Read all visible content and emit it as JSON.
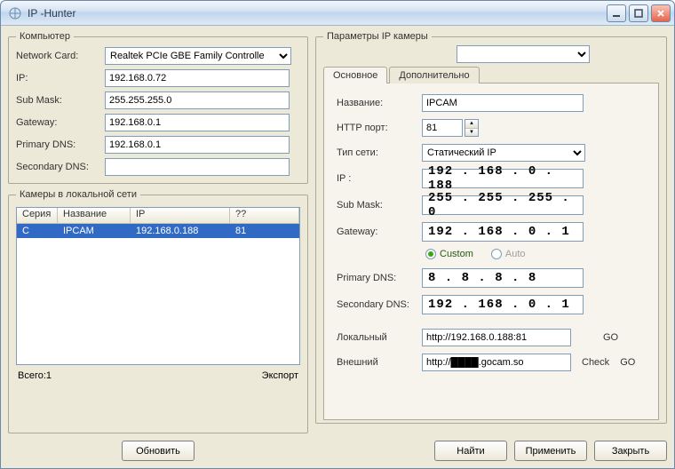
{
  "window": {
    "title": "IP -Hunter"
  },
  "computer": {
    "legend": "Компьютер",
    "network_card_label": "Network Card:",
    "network_card_value": "Realtek PCIe GBE Family Controlle",
    "ip_label": "IP:",
    "ip_value": "192.168.0.72",
    "submask_label": "Sub Mask:",
    "submask_value": "255.255.255.0",
    "gateway_label": "Gateway:",
    "gateway_value": "192.168.0.1",
    "pdns_label": "Primary DNS:",
    "pdns_value": "192.168.0.1",
    "sdns_label": "Secondary DNS:",
    "sdns_value": ""
  },
  "lan": {
    "legend": "Камеры в локальной сети",
    "cols": {
      "serial": "Серия",
      "name": "Название",
      "ip": "IP",
      "unk": "??"
    },
    "rows": [
      {
        "serial": "C",
        "name": "IPCAM",
        "ip": "192.168.0.188",
        "unk": "81",
        "selected": true
      }
    ],
    "total_label": "Всего:1",
    "export_label": "Экспорт"
  },
  "params": {
    "legend": "Параметры IP камеры",
    "selector_value": "",
    "tab_basic": "Основное",
    "tab_adv": "Дополнительно",
    "name_label": "Название:",
    "name_value": "IPCAM",
    "http_label": "HTTP порт:",
    "http_value": "81",
    "nettype_label": "Тип сети:",
    "nettype_value": "Статический IP",
    "ip_label": "IP  :",
    "ip_value": "192 . 168 .  0  . 188",
    "submask_label": "Sub Mask:",
    "submask_value": "255 . 255 . 255 .  0",
    "gateway_label": "Gateway:",
    "gateway_value": "192 . 168 .  0  .  1",
    "radio_custom": "Custom",
    "radio_auto": "Auto",
    "pdns_label": "Primary DNS:",
    "pdns_value": "  8  .  8  .  8  .  8",
    "sdns_label": "Secondary DNS:",
    "sdns_value": "192 . 168 .  0  .  1",
    "local_label": "Локальный",
    "local_value": "http://192.168.0.188:81",
    "ext_label": "Внешний",
    "ext_value": "http://████.gocam.so",
    "go": "GO",
    "check": "Check"
  },
  "buttons": {
    "refresh": "Обновить",
    "find": "Найти",
    "apply": "Применить",
    "close": "Закрыть"
  }
}
